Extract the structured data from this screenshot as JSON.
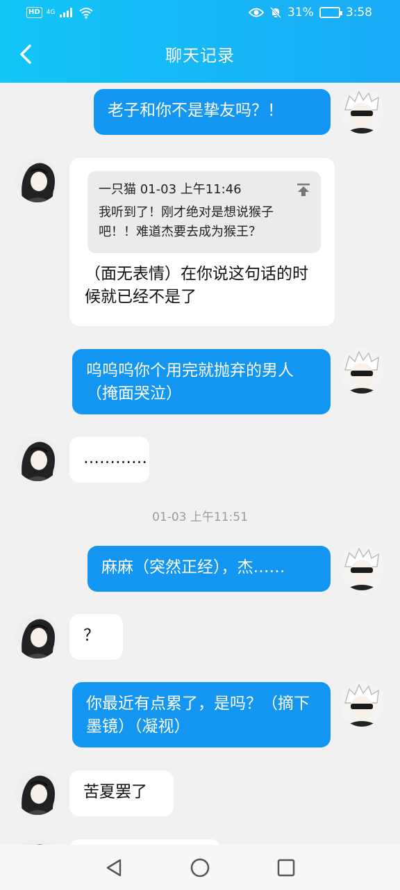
{
  "status_bar": {
    "hd": "HD",
    "network": "4G",
    "battery": "31%",
    "time": "3:58"
  },
  "header": {
    "title": "聊天记录"
  },
  "messages": [
    {
      "text": "老子和你不是挚友吗？！"
    },
    {
      "quote": {
        "header": "一只猫 01-03 上午11:46",
        "text": "我听到了！刚才绝对是想说猴子吧！！难道杰要去成为猴王？"
      },
      "text": "（面无表情）在你说这句话的时候就已经不是了"
    },
    {
      "text": "呜呜呜你个用完就抛弃的男人（掩面哭泣）"
    },
    {
      "text": "…………"
    },
    {
      "text": "麻麻（突然正经），杰……"
    },
    {
      "text": "？"
    },
    {
      "text": "你最近有点累了，是吗？（摘下墨镜）（凝视）"
    },
    {
      "text": "苦夏罢了"
    }
  ],
  "timestamp": "01-03 上午11:51",
  "colors": {
    "header_start": "#12c6f7",
    "header_end": "#1aaaf6",
    "my_bubble": "#1296f1",
    "bg": "#f1f1f1"
  },
  "icons": [
    "back-arrow-icon",
    "eye-icon",
    "mute-bell-icon",
    "battery-icon",
    "nav-back-icon",
    "nav-home-icon",
    "nav-recents-icon"
  ]
}
